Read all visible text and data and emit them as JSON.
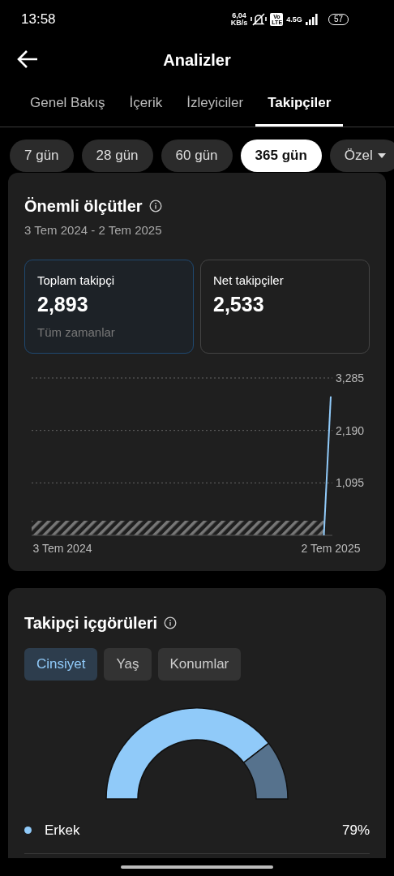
{
  "status_bar": {
    "time": "13:58",
    "net_speed": "6,04",
    "net_unit": "KB/s",
    "volte": "Vo LTE",
    "network": "4.5G",
    "battery": "57"
  },
  "header": {
    "title": "Analizler"
  },
  "tabs": [
    {
      "label": "Genel Bakış",
      "selected": false
    },
    {
      "label": "İçerik",
      "selected": false
    },
    {
      "label": "İzleyiciler",
      "selected": false
    },
    {
      "label": "Takipçiler",
      "selected": true
    }
  ],
  "ranges": [
    {
      "label": "7 gün",
      "selected": false,
      "dropdown": false
    },
    {
      "label": "28 gün",
      "selected": false,
      "dropdown": false
    },
    {
      "label": "60 gün",
      "selected": false,
      "dropdown": false
    },
    {
      "label": "365 gün",
      "selected": true,
      "dropdown": false
    },
    {
      "label": "Özel",
      "selected": false,
      "dropdown": true
    }
  ],
  "key_metrics": {
    "title": "Önemli ölçütler",
    "date_range": "3 Tem 2024 - 2 Tem 2025",
    "metrics": [
      {
        "label": "Toplam takipçi",
        "value": "2,893",
        "note": "Tüm zamanlar",
        "selected": true
      },
      {
        "label": "Net takipçiler",
        "value": "2,533",
        "selected": false
      }
    ],
    "chart_data": {
      "type": "line",
      "categories": [
        "3 Tem 2024",
        null,
        null,
        null,
        null,
        null,
        null,
        null,
        null,
        null,
        null,
        null,
        null,
        null,
        null,
        null,
        null,
        null,
        null,
        null,
        null,
        null,
        null,
        null,
        null,
        null,
        null,
        null,
        null,
        null,
        null,
        null,
        null,
        null,
        null,
        null,
        null,
        null,
        null,
        "2 Tem 2025"
      ],
      "series": [
        {
          "color": "#90caf9",
          "values": [
            null,
            null,
            null,
            null,
            null,
            null,
            null,
            null,
            null,
            null,
            null,
            null,
            null,
            null,
            null,
            null,
            null,
            null,
            null,
            null,
            null,
            null,
            null,
            null,
            null,
            null,
            null,
            null,
            null,
            null,
            null,
            null,
            null,
            null,
            null,
            null,
            null,
            null,
            0,
            2900
          ]
        }
      ],
      "ylim": [
        0,
        3285
      ],
      "yticks": [
        {
          "value": 1095,
          "label": "1,095"
        },
        {
          "value": 2190,
          "label": "2,190"
        },
        {
          "value": 3285,
          "label": "3,285"
        }
      ]
    }
  },
  "insights": {
    "title": "Takipçi içgörüleri",
    "tabs": [
      {
        "label": "Cinsiyet",
        "selected": true
      },
      {
        "label": "Yaş",
        "selected": false
      },
      {
        "label": "Konumlar",
        "selected": false
      }
    ],
    "legend": [
      {
        "label": "Erkek",
        "value": "79%",
        "color": "#90caf9"
      }
    ]
  }
}
